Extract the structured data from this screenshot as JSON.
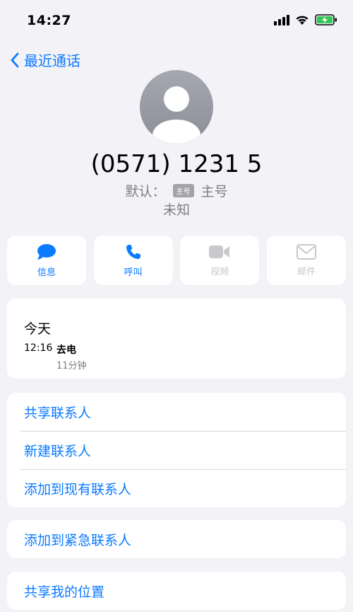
{
  "status_bar": {
    "time": "14:27"
  },
  "nav": {
    "back_label": "最近通话"
  },
  "contact": {
    "phone": "(0571) 1231 5",
    "default_label": "默认：",
    "sim_badge": "主号",
    "sim_name": "主号",
    "status": "未知"
  },
  "actions": [
    {
      "label": "信息",
      "icon": "message-icon",
      "enabled": true
    },
    {
      "label": "呼叫",
      "icon": "phone-icon",
      "enabled": true
    },
    {
      "label": "视频",
      "icon": "video-icon",
      "enabled": false
    },
    {
      "label": "邮件",
      "icon": "mail-icon",
      "enabled": false
    }
  ],
  "recents": {
    "day": "今天",
    "time": "12:16",
    "type": "去电",
    "duration": "11分钟"
  },
  "options_group1": [
    "共享联系人",
    "新建联系人",
    "添加到现有联系人"
  ],
  "options_group2": [
    "添加到紧急联系人"
  ],
  "options_group3": [
    "共享我的位置"
  ],
  "colors": {
    "accent": "#0a7aff",
    "background": "#f2f2f7",
    "disabled": "#c8c8cd"
  }
}
